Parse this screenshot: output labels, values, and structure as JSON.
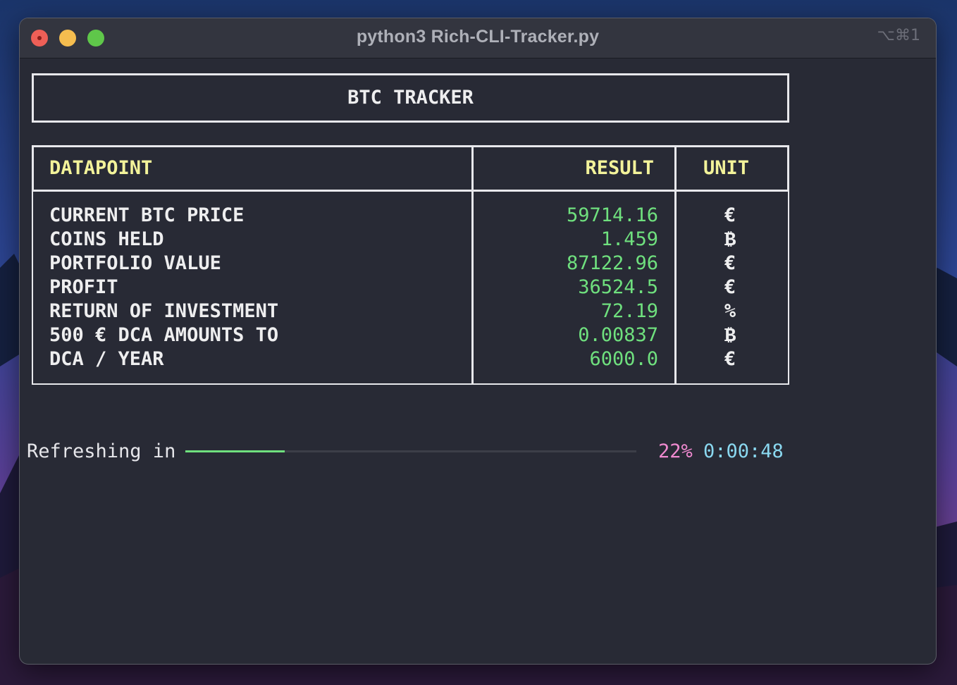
{
  "window": {
    "title": "python3 Rich-CLI-Tracker.py",
    "shortcut": "⌥⌘1"
  },
  "tracker": {
    "title": "BTC TRACKER"
  },
  "table": {
    "headers": {
      "datapoint": "DATAPOINT",
      "result": "RESULT",
      "unit": "UNIT"
    },
    "rows": [
      {
        "datapoint": "CURRENT BTC PRICE",
        "result": "59714.16",
        "unit": "€"
      },
      {
        "datapoint": "COINS HELD",
        "result": "1.459",
        "unit": "₿"
      },
      {
        "datapoint": "PORTFOLIO VALUE",
        "result": "87122.96",
        "unit": "€"
      },
      {
        "datapoint": "PROFIT",
        "result": "36524.5",
        "unit": "€"
      },
      {
        "datapoint": "RETURN OF INVESTMENT",
        "result": "72.19",
        "unit": "%"
      },
      {
        "datapoint": "500 € DCA AMOUNTS TO",
        "result": "0.00837",
        "unit": "₿"
      },
      {
        "datapoint": "DCA / YEAR",
        "result": "6000.0",
        "unit": "€"
      }
    ]
  },
  "progress": {
    "label": "Refreshing in",
    "fraction": 0.22,
    "percent_text": "22%",
    "time_remaining": "0:00:48"
  },
  "colors": {
    "header_text": "#f3f39a",
    "result_text": "#6fe07e",
    "percent_text": "#f08ad0",
    "time_text": "#8ad8f0",
    "terminal_bg": "#282a35"
  }
}
